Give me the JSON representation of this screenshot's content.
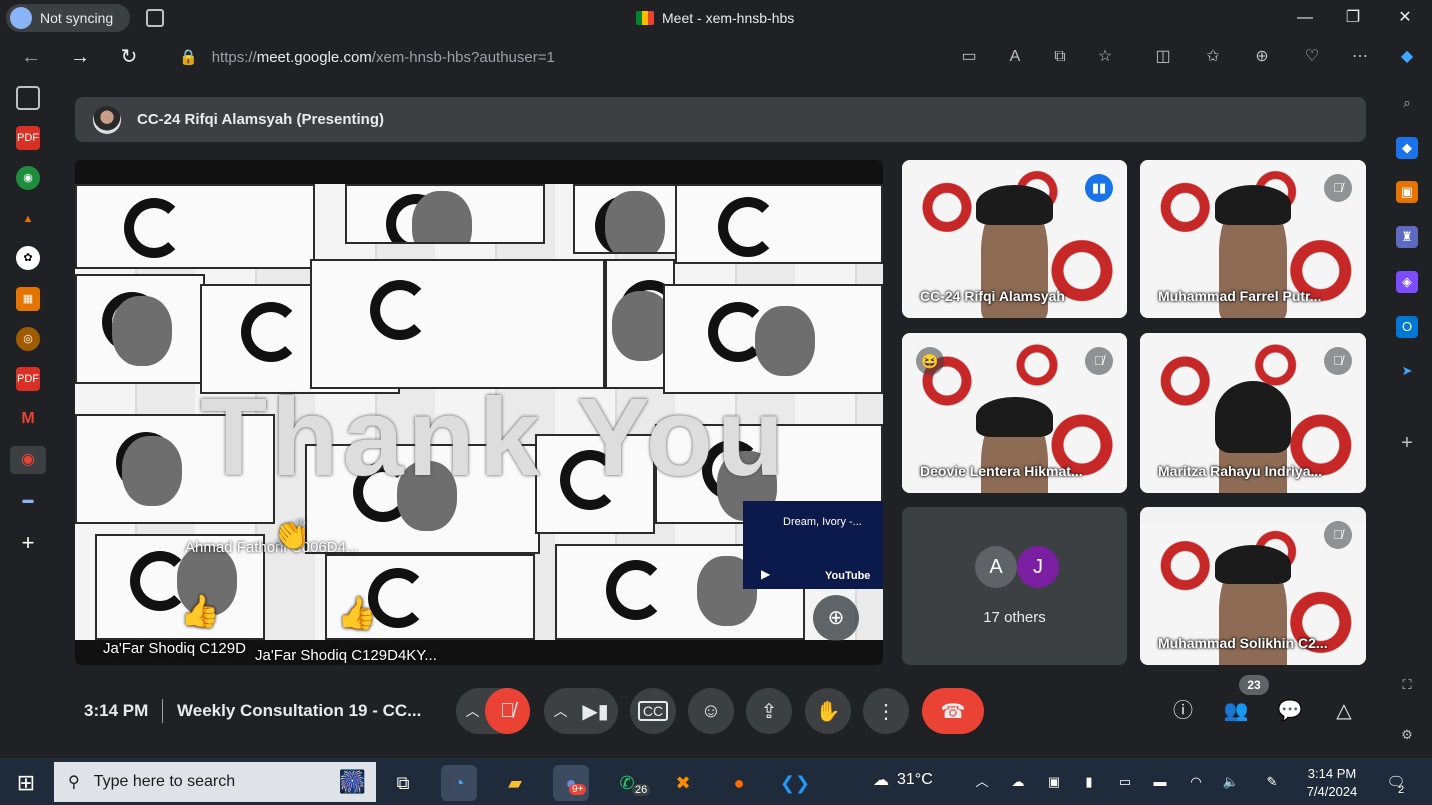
{
  "browser": {
    "profile_label": "Not syncing",
    "window_title": "Meet - xem-hnsb-hbs",
    "url_prefix": "https://",
    "url_host": "meet.google.com",
    "url_path": "/xem-hnsb-hbs?authuser=1"
  },
  "meet": {
    "presenter_banner": "CC-24 Rifqi Alamsyah (Presenting)",
    "presentation_overlay_text": "Thank You",
    "presentation_name_tags": [
      "Ahmad Fathoni C006D4...",
      "Ja'Far Shodiq C129D",
      "Ja'Far Shodiq C129D4KY..."
    ],
    "youtube_card": {
      "title": "Dream, Ivory -...",
      "brand": "YouTube"
    },
    "tiles": [
      {
        "name": "CC-24 Rifqi Alamsyah",
        "status": "speaking"
      },
      {
        "name": "Muhammad Farrel Putr...",
        "status": "muted"
      },
      {
        "name": "Deovie Lentera Hikmat...",
        "status": "muted",
        "reaction": "😆"
      },
      {
        "name": "Maritza Rahayu Indriya...",
        "status": "muted"
      },
      {
        "name": "Muhammad Solikhin C2...",
        "status": "muted"
      }
    ],
    "others": {
      "avatars": [
        "A",
        "J"
      ],
      "avatar_colors": [
        "#5f6368",
        "#7b1fa2"
      ],
      "label": "17 others"
    },
    "meeting_time": "3:14 PM",
    "meeting_title": "Weekly Consultation 19 - CC...",
    "participants_count": "23"
  },
  "taskbar": {
    "search_placeholder": "Type here to search",
    "weather": "31°C",
    "time": "3:14 PM",
    "date": "7/4/2024",
    "notifications": "2",
    "whatsapp_badge": "26",
    "discord_badge": "9+"
  },
  "colors": {
    "accent": "#8ab4f8",
    "end_call": "#ea4335",
    "speaking": "#1a73e8"
  }
}
